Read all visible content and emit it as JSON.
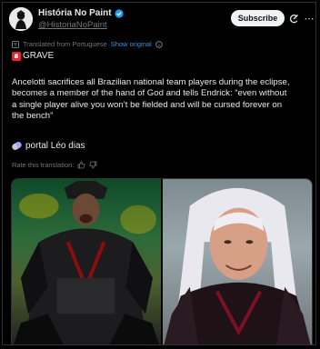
{
  "header": {
    "display_name": "História No Paint",
    "handle": "@HistoriaNoPaint",
    "subscribe_label": "Subscribe",
    "more_glyph": "⋯"
  },
  "translation": {
    "translated_label": "Translated from Portuguese",
    "show_original_label": "Show original"
  },
  "post": {
    "grave_label": "GRAVE",
    "body_lines": [
      "Ancelotti sacrifices all Brazilian national team players during the eclipse,",
      "becomes a member of the hand of God and tells Endrick: “even without",
      "a single player alive you won’t be fielded and will be cursed forever on",
      "the bench”"
    ],
    "source_label": "portal Léo dias",
    "rate_label": "Rate this translation:"
  },
  "icons": {
    "avatar": "avatar-icon",
    "verified": "verified-badge-icon",
    "grok": "grok-icon",
    "more": "more-icon",
    "translate": "translate-icon",
    "info": "info-icon",
    "siren": "siren-emoji-icon",
    "pill": "pill-emoji-icon",
    "thumbs_up": "thumbs-up-icon",
    "thumbs_down": "thumbs-down-icon"
  },
  "colors": {
    "background": "#000000",
    "text": "#e7e9ea",
    "muted": "#71767b",
    "link": "#1d9bf0",
    "verified": "#1d9bf0",
    "subscribe_bg": "#eff3f4"
  }
}
